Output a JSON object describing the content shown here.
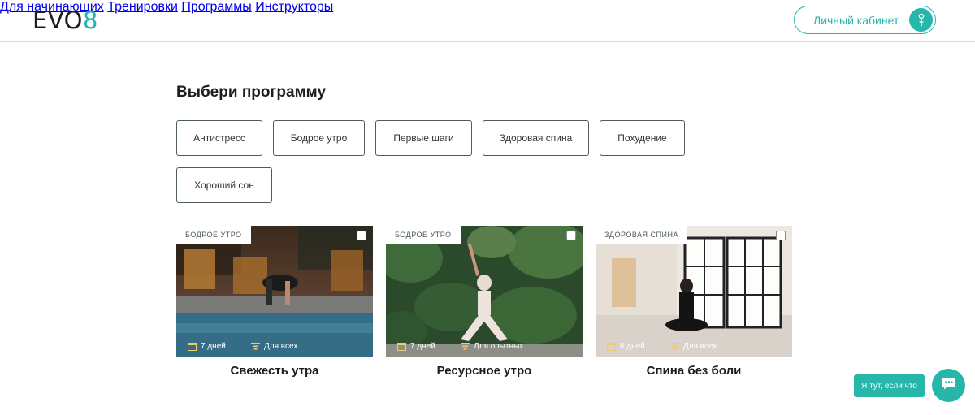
{
  "header": {
    "logo": "EVO",
    "logo_accent": "8",
    "nav": [
      {
        "label": "Для начинающих"
      },
      {
        "label": "Тренировки"
      },
      {
        "label": "Программы"
      },
      {
        "label": "Инструкторы"
      }
    ],
    "account_label": "Личный кабинет",
    "accent_color": "#27b7aa"
  },
  "main": {
    "title": "Выбери программу",
    "filters": [
      "Антистресс",
      "Бодрое утро",
      "Первые шаги",
      "Здоровая спина",
      "Похудение",
      "Хороший сон"
    ],
    "cards": [
      {
        "tag": "БОДРОЕ УТРО",
        "duration": "7 дней",
        "level": "Для всех",
        "title": "Свежесть утра"
      },
      {
        "tag": "БОДРОЕ УТРО",
        "duration": "7 дней",
        "level": "Для опытных",
        "title": "Ресурсное утро"
      },
      {
        "tag": "ЗДОРОВАЯ СПИНА",
        "duration": "6 дней",
        "level": "Для всех",
        "title": "Спина без боли"
      }
    ]
  },
  "chat": {
    "tooltip": "Я тут, если что",
    "icon": "chat-bubble-icon"
  }
}
